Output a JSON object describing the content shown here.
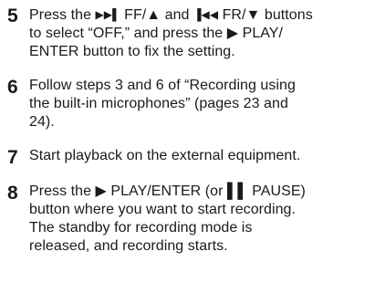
{
  "steps": [
    {
      "number": "5",
      "lines": [
        {
          "pre": "Press the ",
          "icon1": "▶▶▌",
          "mid1": " FF/▲ and ",
          "icon2": "▐◀◀",
          "mid2": " FR/▼ buttons"
        },
        {
          "text": "to select “OFF,” and press the ▶ PLAY/"
        },
        {
          "text": "ENTER button to fix the setting."
        }
      ]
    },
    {
      "number": "6",
      "lines": [
        {
          "text": "Follow steps 3 and 6 of “Recording using"
        },
        {
          "text": "the built-in microphones” (pages 23 and"
        },
        {
          "text": "24)."
        }
      ]
    },
    {
      "number": "7",
      "lines": [
        {
          "text": "Start playback on the external equipment."
        }
      ]
    },
    {
      "number": "8",
      "lines": [
        {
          "text": "Press the ▶ PLAY/ENTER (or ▌▌ PAUSE)"
        },
        {
          "text": "button where you want to start recording."
        },
        {
          "text": "The standby for recording mode is"
        },
        {
          "text": "released, and recording starts."
        }
      ]
    }
  ]
}
